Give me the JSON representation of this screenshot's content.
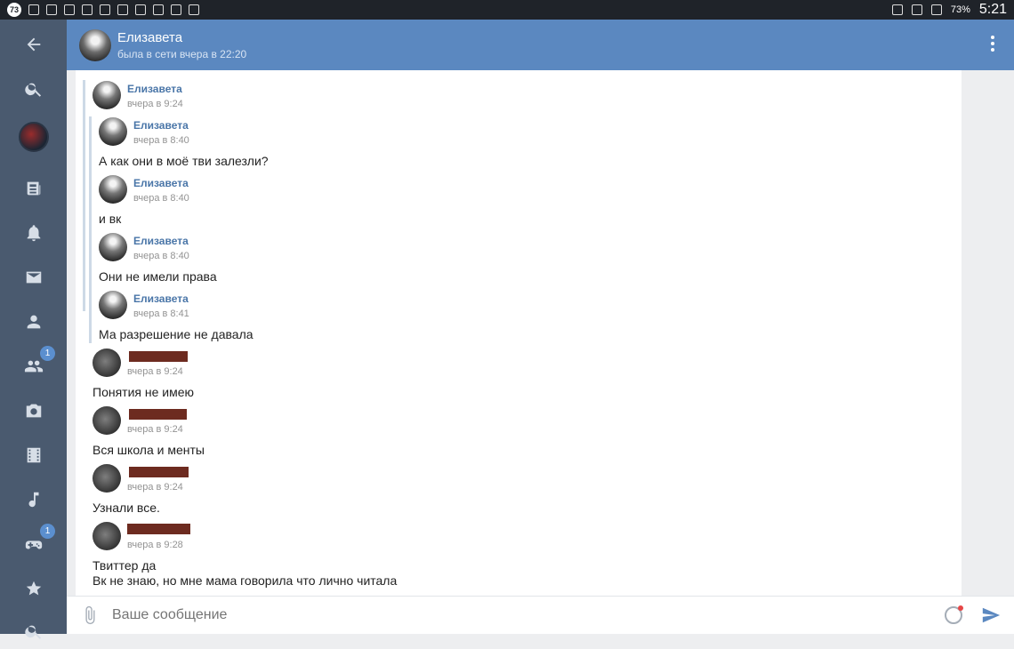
{
  "statusbar": {
    "badge": "73",
    "battery": "73%",
    "time": "5:21"
  },
  "header": {
    "name": "Елизавета",
    "status": "была в сети вчера в 22:20"
  },
  "sidebar": {
    "friends_badge": "1",
    "games_badge": "1"
  },
  "messages": {
    "m1": {
      "name": "Елизавета",
      "time": "вчера в 9:24"
    },
    "f1": {
      "name": "Елизавета",
      "time": "вчера в 8:40",
      "text": "А как они в моё тви залезли?"
    },
    "f2": {
      "name": "Елизавета",
      "time": "вчера в 8:40",
      "text": "и вк"
    },
    "f3": {
      "name": "Елизавета",
      "time": "вчера в 8:40",
      "text": "Они не имели права"
    },
    "f4": {
      "name": "Елизавета",
      "time": "вчера в 8:41",
      "text": "Ма разрешение не давала"
    },
    "m2": {
      "time": "вчера в 9:24",
      "text": "Понятия не имею"
    },
    "m3": {
      "time": "вчера в 9:24",
      "text": "Вся школа и менты"
    },
    "m4": {
      "time": "вчера в 9:24",
      "text": "Узнали все."
    },
    "m5": {
      "time": "вчера в 9:28",
      "text": "Твиттер да",
      "text2": "Вк не знаю, но мне мама говорила что лично читала"
    }
  },
  "input": {
    "placeholder": "Ваше сообщение"
  }
}
